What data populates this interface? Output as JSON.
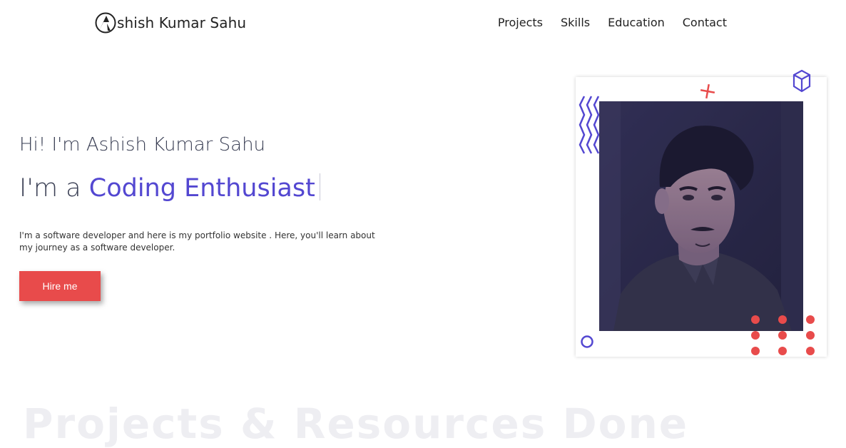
{
  "brand": {
    "name": "shish Kumar Sahu",
    "logo_letter": "A"
  },
  "nav": {
    "items": [
      "Projects",
      "Skills",
      "Education",
      "Contact"
    ]
  },
  "hero": {
    "greeting": "Hi! I'm Ashish Kumar Sahu",
    "role_prefix": "I'm a",
    "role_highlight": "Coding Enthusiast",
    "description": "I'm a software developer and here is my portfolio website . Here, you'll learn about my journey as a software developer.",
    "cta_label": "Hire me"
  },
  "next_section": {
    "heading": "Projects & Resources Done"
  },
  "colors": {
    "accent": "#5347d1",
    "cta": "#e84b4b",
    "text": "#3a3f54"
  },
  "icons": [
    "logo-mark-icon",
    "zigzag-icon",
    "cross-icon",
    "cube-icon",
    "circle-icon",
    "dot-grid-icon"
  ]
}
